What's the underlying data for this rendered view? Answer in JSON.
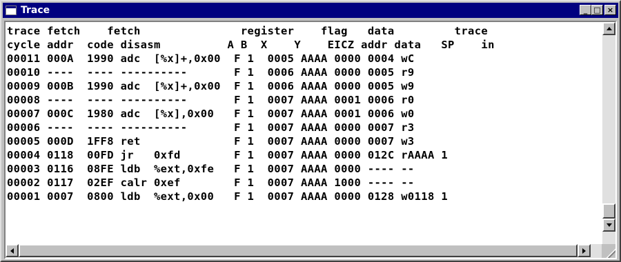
{
  "window": {
    "title": "Trace",
    "controls": {
      "minimize": "_",
      "maximize": "□",
      "close": "×"
    }
  },
  "trace": {
    "header_lines": [
      "trace fetch    fetch               register    flag   data         trace",
      "cycle addr  code disasm          A B  X    Y    EICZ addr data   SP    in"
    ],
    "rows": [
      "00011 000A  1990 adc  [%x]+,0x00  F 1  0005 AAAA 0000 0004 wC",
      "00010 ----  ---- ----------       F 1  0006 AAAA 0000 0005 r9",
      "00009 000B  1990 adc  [%x]+,0x00  F 1  0006 AAAA 0000 0005 w9",
      "00008 ----  ---- ----------       F 1  0007 AAAA 0001 0006 r0",
      "00007 000C  1980 adc  [%x],0x00   F 1  0007 AAAA 0001 0006 w0",
      "00006 ----  ---- ----------       F 1  0007 AAAA 0000 0007 r3",
      "00005 000D  1FF8 ret              F 1  0007 AAAA 0000 0007 w3",
      "00004 0118  00FD jr   0xfd        F 1  0007 AAAA 0000 012C rAAAA 1",
      "00003 0116  08FE ldb  %ext,0xfe   F 1  0007 AAAA 0000 ---- --",
      "00002 0117  02EF calr 0xef        F 1  0007 AAAA 1000 ---- --",
      "00001 0007  0800 ldb  %ext,0x00   F 1  0007 AAAA 0000 0128 w0118 1"
    ]
  },
  "colors": {
    "titlebar": "#000080",
    "face": "#c0c0c0",
    "client": "#ffffff"
  }
}
